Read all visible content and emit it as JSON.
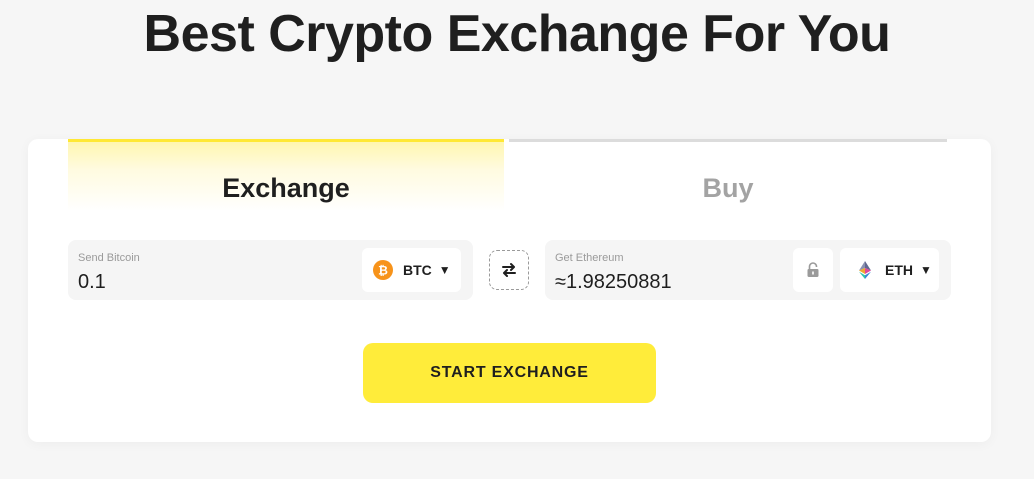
{
  "page": {
    "title": "Best Crypto Exchange For You"
  },
  "tabs": [
    {
      "label": "Exchange",
      "active": true
    },
    {
      "label": "Buy",
      "active": false
    }
  ],
  "send": {
    "label": "Send Bitcoin",
    "value": "0.1",
    "currency": {
      "code": "BTC",
      "icon": "bitcoin-icon",
      "color": "#f7931a"
    }
  },
  "get": {
    "label": "Get Ethereum",
    "value": "≈1.98250881",
    "currency": {
      "code": "ETH",
      "icon": "ethereum-icon"
    }
  },
  "actions": {
    "start_label": "START EXCHANGE"
  },
  "colors": {
    "accent": "#ffec3a",
    "tab_active_bar": "#ffe834",
    "tab_inactive_bar": "#dcdcdc",
    "background": "#f6f6f6"
  }
}
